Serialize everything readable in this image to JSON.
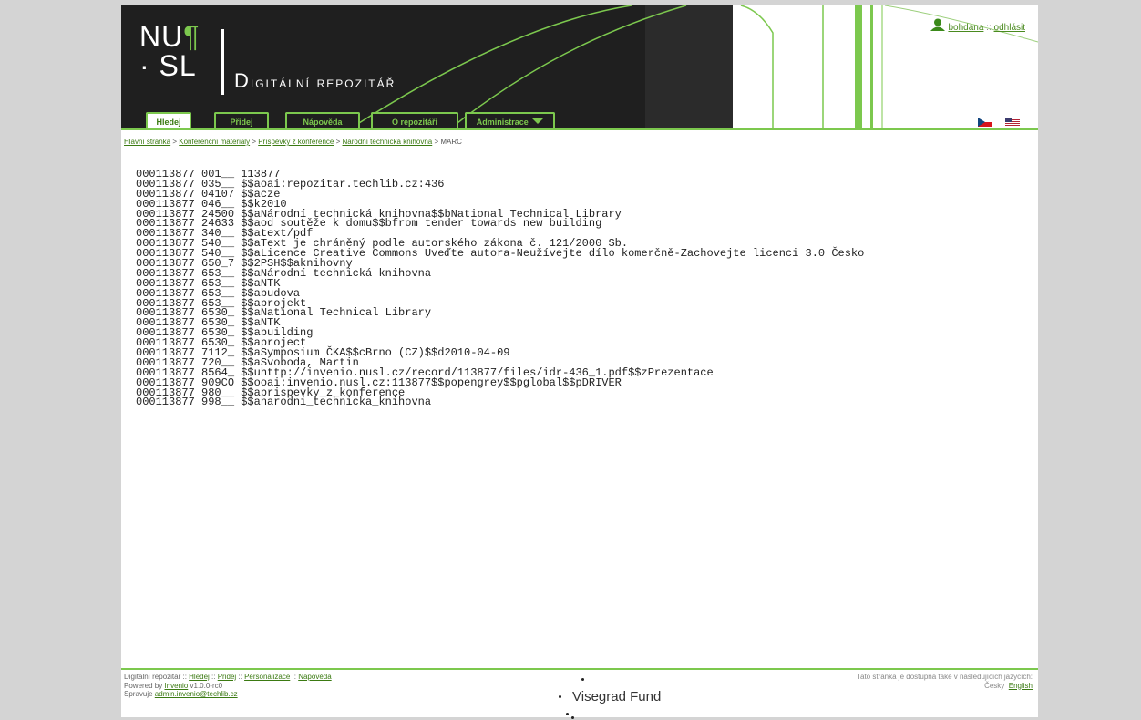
{
  "header": {
    "logo_line1": "NU",
    "logo_mark": "¶",
    "logo_line2": "· SL",
    "brand_first": "D",
    "brand_rest": "igitální repozitář",
    "user": {
      "name": "bohdana",
      "separator": " :: ",
      "logout": "odhlásit"
    },
    "tabs": [
      {
        "label": "Hledej",
        "active": true
      },
      {
        "label": "Přidej",
        "active": false
      },
      {
        "label": "Nápověda",
        "active": false
      },
      {
        "label": "O repozitáři",
        "active": false
      },
      {
        "label": "Administrace",
        "active": false
      }
    ],
    "dropdown_icon": "chevron-down-icon",
    "flags": [
      "czech-flag-icon",
      "us-flag-icon"
    ]
  },
  "colors": {
    "accent": "#7cc84e",
    "dark": "#1f1f1f",
    "link": "#3b7a12"
  },
  "breadcrumb": {
    "items": [
      "Hlavní stránka",
      "Konferenční materiály",
      "Příspěvky z konference",
      "Národní technická knihovna"
    ],
    "current": "MARC",
    "separator": " > "
  },
  "marc_lines": [
    "000113877 001__ 113877",
    "000113877 035__ $$aoai:repozitar.techlib.cz:436",
    "000113877 04107 $$acze",
    "000113877 046__ $$k2010",
    "000113877 24500 $$aNárodní technická knihovna$$bNational Technical Library",
    "000113877 24633 $$aod soutěže k domu$$bfrom tender towards new building",
    "000113877 340__ $$atext/pdf",
    "000113877 540__ $$aText je chráněný podle autorského zákona č. 121/2000 Sb.",
    "000113877 540__ $$aLicence Creative Commons Uveďte autora-Neužívejte dílo komerčně-Zachovejte licenci 3.0 Česko",
    "000113877 650_7 $$2PSH$$aknihovny",
    "000113877 653__ $$aNárodní technická knihovna",
    "000113877 653__ $$aNTK",
    "000113877 653__ $$abudova",
    "000113877 653__ $$aprojekt",
    "000113877 6530_ $$aNational Technical Library",
    "000113877 6530_ $$aNTK",
    "000113877 6530_ $$abuilding",
    "000113877 6530_ $$aproject",
    "000113877 7112_ $$aSymposium ČKA$$cBrno (CZ)$$d2010-04-09",
    "000113877 720__ $$aSvoboda, Martin",
    "000113877 8564_ $$uhttp://invenio.nusl.cz/record/113877/files/idr-436_1.pdf$$zPrezentace",
    "000113877 909CO $$ooai:invenio.nusl.cz:113877$$popengrey$$pglobal$$pDRIVER",
    "000113877 980__ $$aprispevky_z_konference",
    "000113877 998__ $$anarodni_technicka_knihovna"
  ],
  "footer": {
    "site_name": "Digitální repozitář",
    "sep": " :: ",
    "links": [
      "Hledej",
      "Přidej",
      "Personalizace",
      "Nápověda"
    ],
    "powered_prefix": "Powered by ",
    "powered_link": "Invenio",
    "powered_version": " v1.0.0-rc0",
    "maintained_prefix": "Spravuje ",
    "maintained_email": "admin.invenio@techlib.cz",
    "lang_note": "Tato stránka je dostupná také v následujících jazycích:",
    "lang_current": "Česky",
    "lang_other": "English",
    "visegrad": "Visegrad Fund"
  }
}
